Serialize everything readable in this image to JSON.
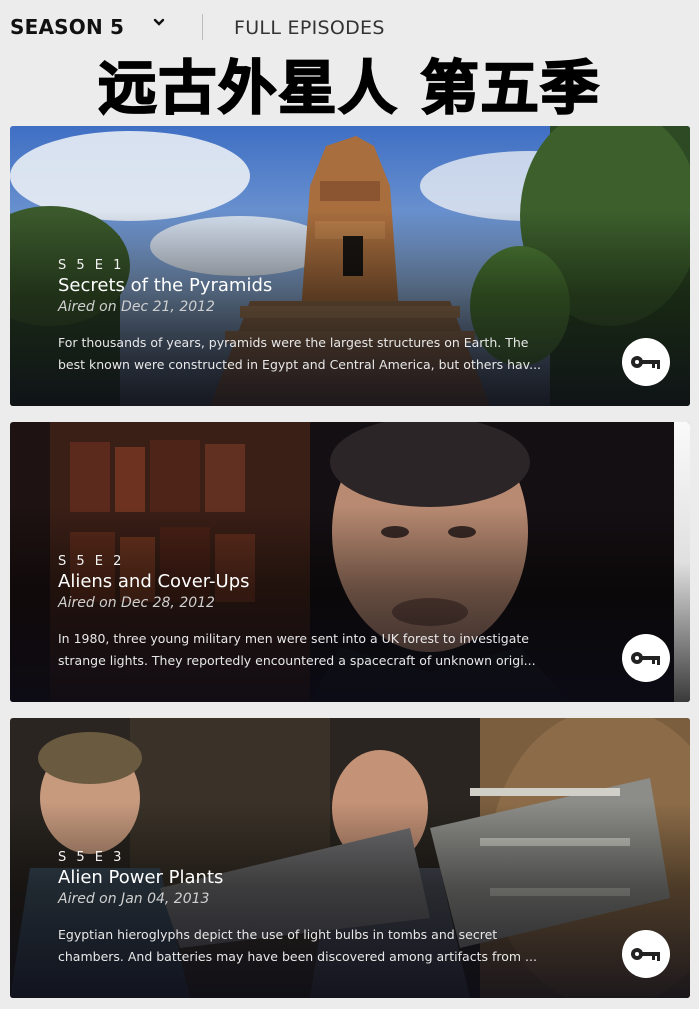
{
  "header": {
    "season_label": "SEASON 5",
    "full_episodes_label": "FULL EPISODES"
  },
  "banner": {
    "title": "远古外星人 第五季"
  },
  "episodes": [
    {
      "code": "S 5 E 1",
      "title": "Secrets of the Pyramids",
      "aired": "Aired on Dec 21, 2012",
      "description_line1": "For thousands of years, pyramids were the largest structures on Earth. The",
      "description_line2": "best known were constructed in Egypt and Central America, but others hav...",
      "action_icon": "key-icon"
    },
    {
      "code": "S 5 E 2",
      "title": "Aliens and Cover-Ups",
      "aired": "Aired on Dec 28, 2012",
      "description_line1": "In 1980, three young military men were sent into a UK forest to investigate",
      "description_line2": "strange lights. They reportedly encountered a spacecraft of unknown origi...",
      "action_icon": "key-icon"
    },
    {
      "code": "S 5 E 3",
      "title": "Alien Power Plants",
      "aired": "Aired on Jan 04, 2013",
      "description_line1": "Egyptian hieroglyphs depict the use of light bulbs in tombs and secret",
      "description_line2": "chambers. And batteries may have been discovered among artifacts from ...",
      "action_icon": "key-icon"
    }
  ]
}
